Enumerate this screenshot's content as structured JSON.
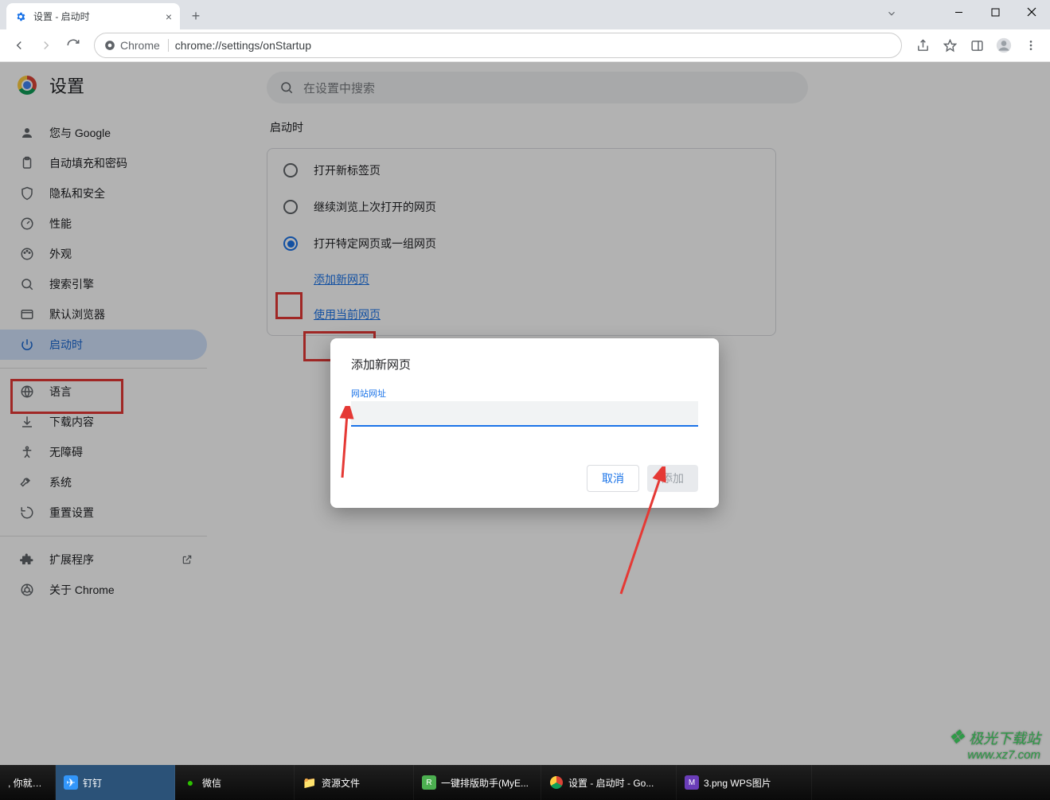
{
  "window": {
    "tab_title": "设置 - 启动时",
    "new_tab_tooltip": "新标签页"
  },
  "toolbar": {
    "security_chip": "Chrome",
    "url": "chrome://settings/onStartup"
  },
  "app": {
    "title": "设置",
    "search_placeholder": "在设置中搜索"
  },
  "sidebar": {
    "items": [
      {
        "label": "您与 Google",
        "icon": "person-icon"
      },
      {
        "label": "自动填充和密码",
        "icon": "clipboard-icon"
      },
      {
        "label": "隐私和安全",
        "icon": "shield-icon"
      },
      {
        "label": "性能",
        "icon": "speed-icon"
      },
      {
        "label": "外观",
        "icon": "palette-icon"
      },
      {
        "label": "搜索引擎",
        "icon": "search-icon"
      },
      {
        "label": "默认浏览器",
        "icon": "browser-icon"
      },
      {
        "label": "启动时",
        "icon": "power-icon",
        "active": true
      }
    ],
    "items2": [
      {
        "label": "语言",
        "icon": "globe-icon"
      },
      {
        "label": "下载内容",
        "icon": "download-icon"
      },
      {
        "label": "无障碍",
        "icon": "accessibility-icon"
      },
      {
        "label": "系统",
        "icon": "wrench-icon"
      },
      {
        "label": "重置设置",
        "icon": "reset-icon"
      }
    ],
    "items3": [
      {
        "label": "扩展程序",
        "icon": "extension-icon",
        "external": true
      },
      {
        "label": "关于 Chrome",
        "icon": "chrome-icon"
      }
    ]
  },
  "startup": {
    "section_title": "启动时",
    "options": [
      {
        "label": "打开新标签页",
        "selected": false
      },
      {
        "label": "继续浏览上次打开的网页",
        "selected": false
      },
      {
        "label": "打开特定网页或一组网页",
        "selected": true
      }
    ],
    "add_page_link": "添加新网页",
    "use_current_link": "使用当前网页"
  },
  "dialog": {
    "title": "添加新网页",
    "field_label": "网站网址",
    "field_value": "",
    "cancel": "取消",
    "confirm": "添加"
  },
  "taskbar": {
    "items": [
      {
        "label": ", 你就知...",
        "icon": ""
      },
      {
        "label": "钉钉",
        "icon": "dingtalk",
        "active": true
      },
      {
        "label": "微信",
        "icon": "wechat"
      },
      {
        "label": "资源文件",
        "icon": "folder"
      },
      {
        "label": "一键排版助手(MyE...",
        "icon": "app"
      },
      {
        "label": "设置 - 启动时 - Go...",
        "icon": "chrome"
      },
      {
        "label": "3.png  WPS图片",
        "icon": "wps"
      }
    ]
  },
  "watermark": {
    "line1": "极光下载站",
    "line2": "www.xz7.com"
  }
}
